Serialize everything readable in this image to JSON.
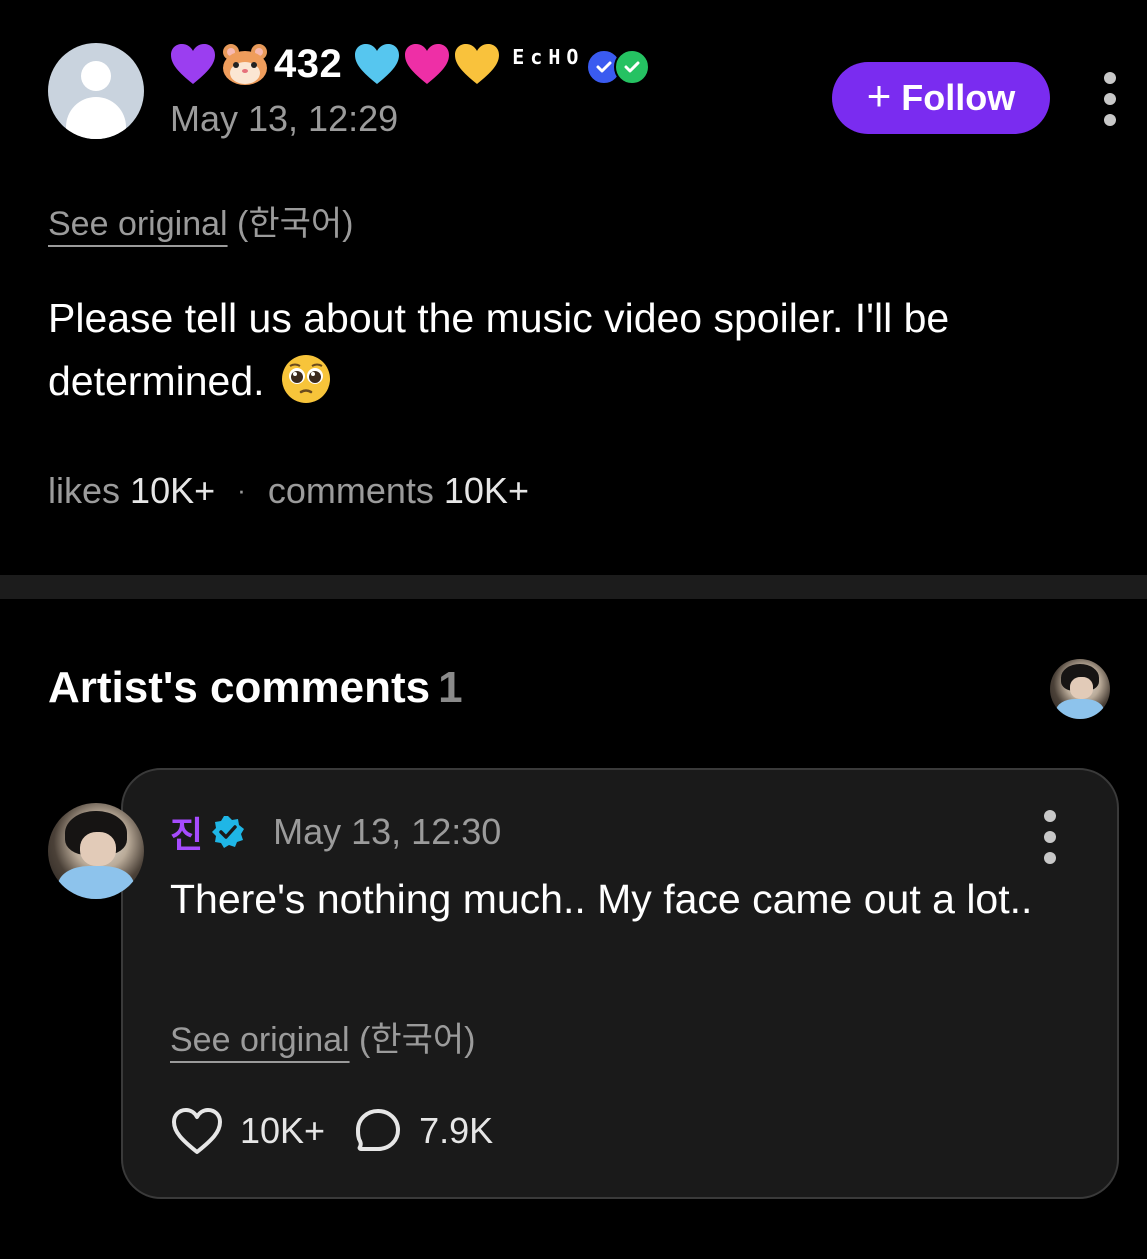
{
  "post": {
    "author_badges": {
      "hearts": [
        "purple-heart",
        "light-blue-heart",
        "pink-heart",
        "yellow-heart"
      ],
      "hamster_emoji": "hamster-face",
      "number": "432",
      "echo_text": "EcHO",
      "badge_icons": [
        "blue-shield-check-badge",
        "green-check-badge"
      ]
    },
    "date": "May 13, 12:29",
    "follow_label": "Follow",
    "see_original_label": "See original",
    "original_language": "(한국어)",
    "body": "Please tell us about the music video spoiler. I'll be determined.",
    "body_emoji": "pleading-face",
    "stats": {
      "likes_label": "likes",
      "likes_value": "10K+",
      "separator": "·",
      "comments_label": "comments",
      "comments_value": "10K+"
    }
  },
  "artist_comments": {
    "title": "Artist's comments",
    "count": "1"
  },
  "comment": {
    "author": "진",
    "date": "May 13, 12:30",
    "text": "There's nothing much.. My face came out a lot..",
    "see_original_label": "See original",
    "original_language": "(한국어)",
    "likes": "10K+",
    "replies": "7.9K"
  },
  "colors": {
    "background": "#000000",
    "accent_purple": "#7a2cf0",
    "artist_name": "#a64bff",
    "verified_blue": "#1fb6e6",
    "muted_text": "#9b9b9b",
    "card_bg": "#1a1a1a"
  }
}
